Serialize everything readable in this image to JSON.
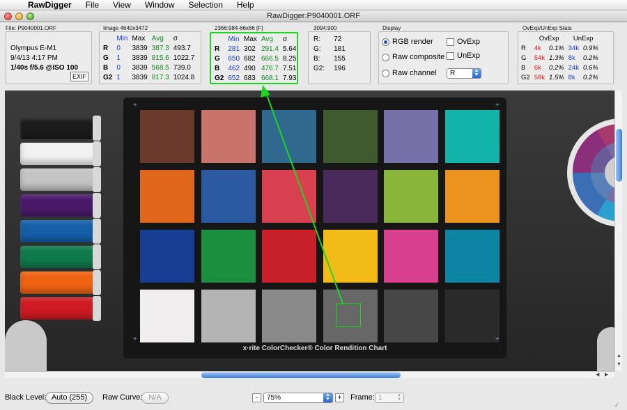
{
  "menubar": {
    "app": "RawDigger",
    "items": [
      "File",
      "View",
      "Window",
      "Selection",
      "Help"
    ]
  },
  "window": {
    "title": "RawDigger:P9040001.ORF"
  },
  "file_panel": {
    "title": "File: P9040001.ORF",
    "camera": "Olympus E-M1",
    "date": "9/4/13 4:17 PM",
    "exposure": "1/40s f/5.6 @ISO 100",
    "exif_button": "EXIF"
  },
  "image_panel": {
    "title": "Image 4640x3472",
    "headers": [
      "Min",
      "Max",
      "Avg",
      "σ"
    ],
    "rows": [
      {
        "ch": "R",
        "min": "0",
        "max": "3839",
        "avg": "387.3",
        "sd": "493.7"
      },
      {
        "ch": "G",
        "min": "1",
        "max": "3839",
        "avg": "815.6",
        "sd": "1022.7"
      },
      {
        "ch": "B",
        "min": "0",
        "max": "3839",
        "avg": "568.5",
        "sd": "739.0"
      },
      {
        "ch": "G2",
        "min": "1",
        "max": "3839",
        "avg": "817.3",
        "sd": "1024.8"
      }
    ]
  },
  "selection_panel": {
    "title": "2366:984-66x66 [F]",
    "headers": [
      "Min",
      "Max",
      "Avg",
      "σ"
    ],
    "rows": [
      {
        "ch": "R",
        "min": "281",
        "max": "302",
        "avg": "291.4",
        "sd": "5.64"
      },
      {
        "ch": "G",
        "min": "650",
        "max": "682",
        "avg": "666.5",
        "sd": "8.25"
      },
      {
        "ch": "B",
        "min": "462",
        "max": "490",
        "avg": "476.7",
        "sd": "7.51"
      },
      {
        "ch": "G2",
        "min": "652",
        "max": "683",
        "avg": "668.1",
        "sd": "7.93"
      }
    ]
  },
  "pixel_panel": {
    "title": "3094:900",
    "rows": [
      {
        "ch": "R:",
        "val": "72"
      },
      {
        "ch": "G:",
        "val": "181"
      },
      {
        "ch": "B:",
        "val": "155"
      },
      {
        "ch": "G2:",
        "val": "196"
      }
    ]
  },
  "display_panel": {
    "title": "Display",
    "rgb_render": "RGB render",
    "raw_composite": "Raw composite",
    "raw_channel": "Raw channel",
    "ovexp": "OvExp",
    "unexp": "UnExp",
    "channel_value": "R"
  },
  "ovexp_panel": {
    "title": "OvExp/UnExp Stats",
    "headers": [
      "OvExp",
      "UnExp"
    ],
    "rows": [
      {
        "ch": "R",
        "ov": "4k",
        "ovp": "0.1%",
        "un": "34k",
        "unp": "0.9%"
      },
      {
        "ch": "G",
        "ov": "54k",
        "ovp": "1.3%",
        "un": "8k",
        "unp": "0.2%"
      },
      {
        "ch": "B",
        "ov": "6k",
        "ovp": "0.2%",
        "un": "24k",
        "unp": "0.6%"
      },
      {
        "ch": "G2",
        "ov": "58k",
        "ovp": "1.5%",
        "un": "8k",
        "unp": "0.2%"
      }
    ]
  },
  "colorchecker": {
    "label": "x·rite ColorChecker® Color Rendition Chart",
    "patches": [
      "#6b3a2c",
      "#c9746a",
      "#2f6a8e",
      "#3f5a2e",
      "#7670a8",
      "#12b3a8",
      "#e0661b",
      "#2c5aa0",
      "#d8404f",
      "#4a2a5a",
      "#8ab53b",
      "#ec931e",
      "#173e93",
      "#1b8f3e",
      "#c8202a",
      "#f2bb17",
      "#d93f8f",
      "#0e84a4",
      "#f0edef",
      "#b4b4b4",
      "#8a8a8a",
      "#676767",
      "#474747",
      "#2a2a2a"
    ]
  },
  "threads": [
    "#1b1b1b",
    "#f1f1f1",
    "#c4c4c4",
    "#4a1a6a",
    "#155ea8",
    "#0f7a4a",
    "#ef6312",
    "#cf1b22"
  ],
  "bottom": {
    "black_level_label": "Black Level:",
    "black_level_value": "Auto (255)",
    "raw_curve_label": "Raw Curve:",
    "raw_curve_value": "N/A",
    "zoom_minus": "-",
    "zoom_value": "75%",
    "zoom_plus": "+",
    "frame_label": "Frame:",
    "frame_value": "1"
  }
}
